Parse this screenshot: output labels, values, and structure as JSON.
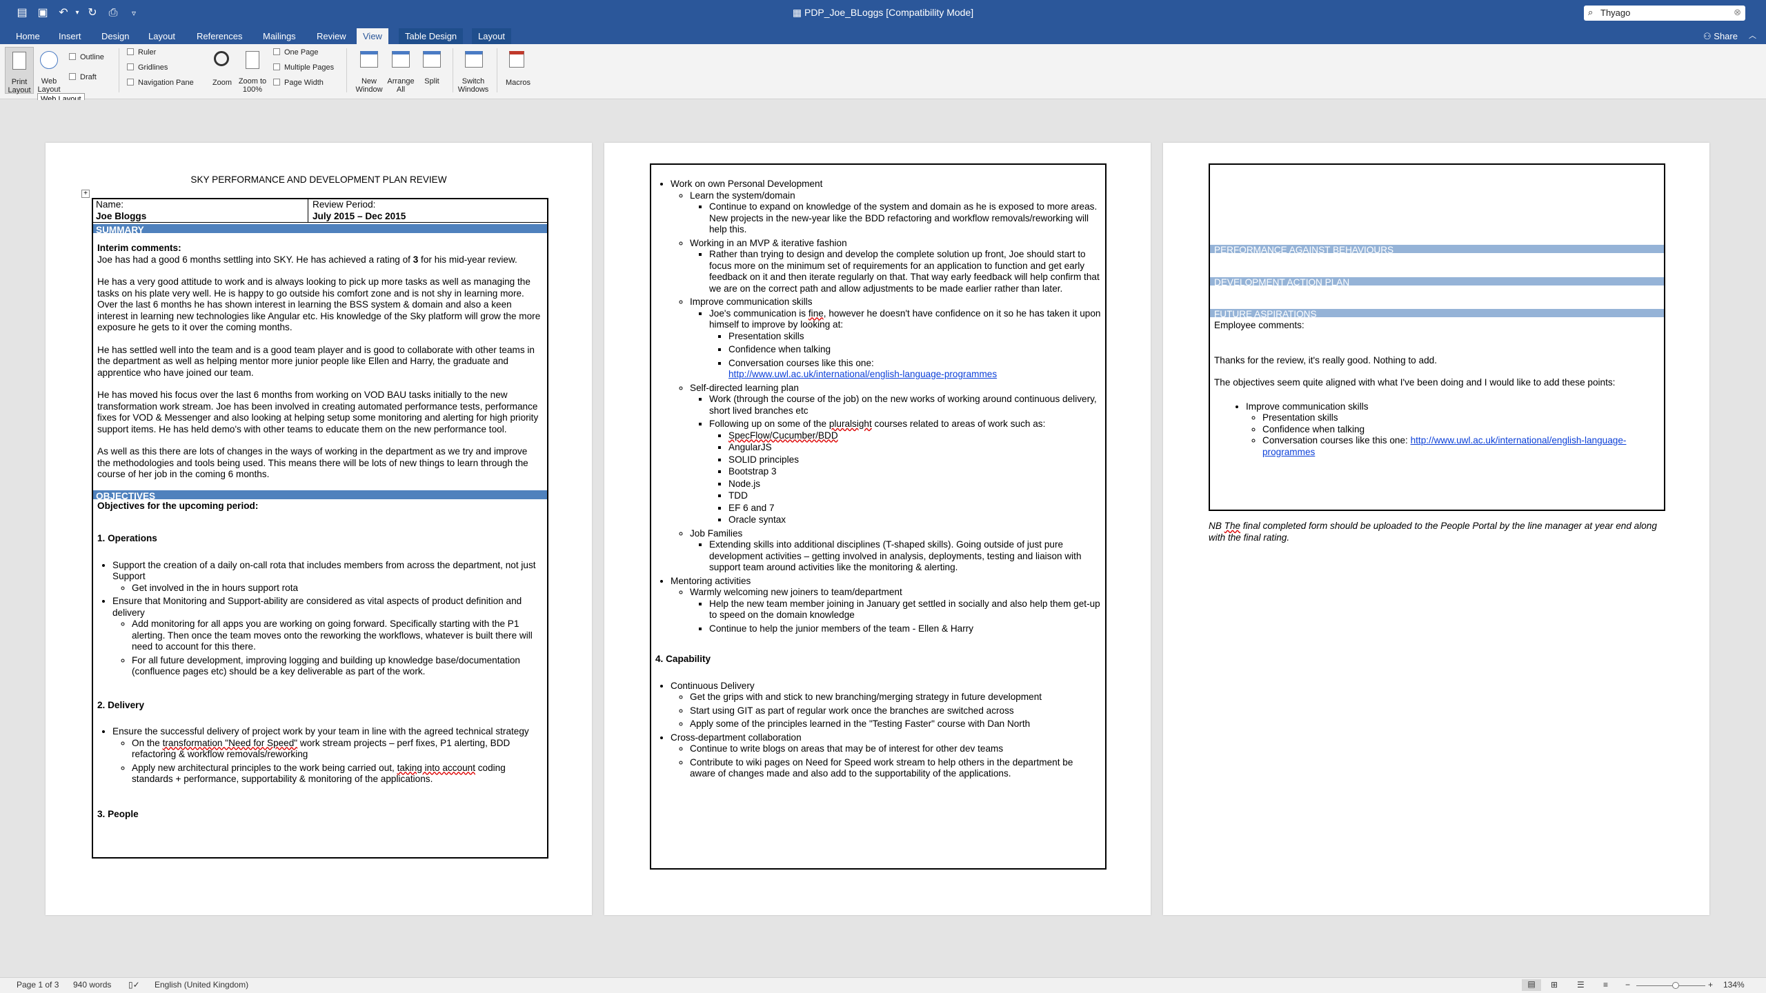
{
  "window": {
    "title": "PDP_Joe_BLoggs [Compatibility Mode]",
    "search_value": "Thyago",
    "share_label": "Share"
  },
  "tabs": [
    "Home",
    "Insert",
    "Design",
    "Layout",
    "References",
    "Mailings",
    "Review",
    "View",
    "Table Design",
    "Layout"
  ],
  "ribbon": {
    "print_layout": "Print Layout",
    "web_layout": "Web Layout",
    "outline": "Outline",
    "draft": "Draft",
    "ruler": "Ruler",
    "gridlines": "Gridlines",
    "navigation_pane": "Navigation Pane",
    "zoom": "Zoom",
    "zoom100": "Zoom to 100%",
    "one_page": "One Page",
    "multiple_pages": "Multiple Pages",
    "page_width": "Page Width",
    "new_window": "New Window",
    "arrange_all": "Arrange All",
    "split": "Split",
    "switch_windows": "Switch Windows",
    "macros": "Macros",
    "tooltip": "Web Layout"
  },
  "page1": {
    "heading": "SKY PERFORMANCE AND DEVELOPMENT PLAN REVIEW",
    "name_label": "Name:",
    "name_value": "Joe Bloggs",
    "period_label": "Review Period:",
    "period_value": "July 2015 – Dec 2015",
    "summary": "SUMMARY",
    "interim_label": "Interim comments:",
    "para1_a": "Joe has had a good 6 months settling into SKY. He has achieved a rating of ",
    "para1_b": "3",
    "para1_c": " for his mid-year review.",
    "para2": "He has a very good attitude to work and is always looking to pick up more tasks as well as managing the tasks on his plate very well. He is happy to go outside his comfort zone and is not shy in learning more. Over the last 6 months he has shown interest in learning the BSS system & domain and also a keen interest in learning new technologies like Angular etc. His knowledge of the Sky platform will grow the more exposure he gets to it over the coming months.",
    "para3": "He has settled well into the team and is a good team player and is good to collaborate with other teams in the department as well as helping mentor more junior people like Ellen and Harry, the graduate and apprentice who have joined our team.",
    "para4": "He has moved his focus over the last 6 months from working on VOD BAU tasks initially to the new transformation work stream. Joe has been involved in creating automated performance tests, performance fixes for VOD & Messenger and also looking at helping setup some monitoring and alerting for high priority support items. He has held demo's with other teams to educate them on the new performance tool.",
    "para5": "As well as this there are lots of changes in the ways of working in the department as we try and improve the methodologies and tools being used.  This means there will be lots of new things to learn through the course of her job in the coming 6 months.",
    "objectives": "OBJECTIVES",
    "objectives_label": "Objectives for the upcoming period:",
    "ops_heading": "1. Operations",
    "ops1": "Support the creation of a daily on-call rota that includes members from across the department, not just Support",
    "ops1_1": "Get involved in the in hours support rota",
    "ops2": "Ensure that Monitoring and Support-ability are considered as vital aspects of product definition and delivery",
    "ops2_1": "Add monitoring for all apps you are working on going forward. Specifically starting with the P1 alerting. Then once the team moves onto the reworking the workflows, whatever is built there will need to account for this there.",
    "ops2_2": "For all future development, improving logging and building up knowledge base/documentation (confluence pages etc) should be a key deliverable as part of the work.",
    "delivery_heading": "2. Delivery",
    "del1": "Ensure the successful delivery of project work by your team in line with the agreed technical strategy",
    "del1_1a": "On the ",
    "del1_1b": "transformation  \"Need for Speed\"",
    "del1_1c": " work stream projects – perf fixes, P1 alerting, BDD refactoring & workflow removals/reworking",
    "del1_2a": "Apply new architectural principles to the work being carried out, ",
    "del1_2b": "taking into account",
    "del1_2c": " coding standards + performance, supportability & monitoring of the applications.",
    "people_heading": "3. People"
  },
  "page2": {
    "a": "Work on own Personal Development",
    "a1": "Learn the system/domain",
    "a1_1": "Continue to expand on knowledge of the system and domain as he is exposed to more areas. New projects in the new-year like the BDD refactoring and workflow removals/reworking will help this.",
    "a2": "Working in an MVP & iterative fashion",
    "a2_1": "Rather than trying to design and develop the complete solution up front, Joe should start to focus more on the minimum set of requirements for an application to function and get early feedback on it and then iterate regularly on that. That way early feedback will help confirm that we are on the correct path and allow adjustments to be made earlier rather than later.",
    "a3": "Improve communication skills",
    "a3_1a": "Joe's communication is ",
    "a3_1b": "fine,",
    "a3_1c": " however he doesn't have confidence on it so he has taken it upon himself to improve by looking at:",
    "a3_1_1": "Presentation skills",
    "a3_1_2": "Confidence when talking",
    "a3_1_3": "Conversation courses like this one:",
    "a3_link": "http://www.uwl.ac.uk/international/english-language-programmes",
    "a4": "Self-directed learning plan",
    "a4_1": "Work (through the course of the job) on the new works of working around continuous delivery, short lived branches etc",
    "a4_2a": "Following up on some of the ",
    "a4_2b": "pluralsight",
    "a4_2c": " courses related to areas of work such as:",
    "courses": [
      "SpecFlow/Cucumber/BDD",
      "AngularJS",
      "SOLID principles",
      "Bootstrap 3",
      "Node.js",
      "TDD",
      "EF 6 and 7",
      "Oracle syntax"
    ],
    "a5": "Job Families",
    "a5_1": "Extending skills into additional disciplines (T-shaped skills). Going outside of just pure development activities – getting involved in analysis, deployments, testing and liaison with support team around activities like the monitoring & alerting.",
    "b": "Mentoring activities",
    "b1": "Warmly welcoming new joiners to team/department",
    "b1_1": "Help the new team member joining in January get settled in socially and also help them get-up to speed on the domain knowledge",
    "b1_2": "Continue to help the junior members of the team - Ellen & Harry",
    "capability_heading": "4. Capability",
    "c": "Continuous Delivery",
    "c1": "Get the grips with and stick to new branching/merging strategy in future development",
    "c2": "Start using GIT as part of regular work once the branches are switched across",
    "c3": "Apply some of the principles learned in the \"Testing Faster\" course with Dan North",
    "d": "Cross-department collaboration",
    "d1": "Continue to write blogs on areas that may be of interest for other dev teams",
    "d2": "Contribute to wiki pages on Need for Speed work stream to help others in the department be aware of changes made and also add to the supportability of the applications."
  },
  "page3": {
    "perf": "PERFORMANCE AGAINST BEHAVIOURS",
    "dev": "DEVELOPMENT ACTION PLAN",
    "future": "FUTURE ASPIRATIONS",
    "emp": "Employee comments:",
    "thanks": "Thanks for the review, it's really good. Nothing to add.",
    "objectives": "The objectives seem quite aligned with what I've been doing and I would like to add these points:",
    "li1": "Improve communication skills",
    "li1_1": "Presentation skills",
    "li1_2": "Confidence when talking",
    "li1_3": "Conversation courses like this one: ",
    "link": "http://www.uwl.ac.uk/international/english-language-programmes",
    "note_a": "NB ",
    "note_b": "The",
    "note_c": " final completed form should be uploaded to the People Portal by the line manager at year end along with the final rating."
  },
  "status": {
    "page": "Page 1 of 3",
    "words": "940 words",
    "language": "English (United Kingdom)",
    "zoom": "134%"
  }
}
